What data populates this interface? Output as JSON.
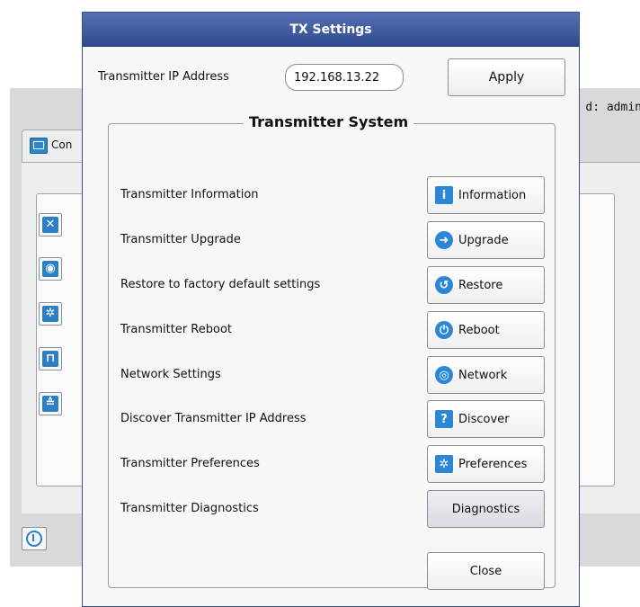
{
  "background": {
    "user_text": "d: admin",
    "tab_label": "Con",
    "icons": [
      "tools-icon",
      "globe-icon",
      "gear-icon",
      "lock-icon",
      "broadcast-icon"
    ],
    "footer_icon": "info-icon"
  },
  "dialog": {
    "title": "TX Settings",
    "ip_label": "Transmitter IP Address",
    "ip_value": "192.168.13.22",
    "apply_label": "Apply",
    "group_title": "Transmitter System",
    "rows": [
      {
        "label": "Transmitter Information",
        "button": "Information",
        "icon": "info-icon"
      },
      {
        "label": "Transmitter Upgrade",
        "button": "Upgrade",
        "icon": "upgrade-icon"
      },
      {
        "label": "Restore to factory default settings",
        "button": "Restore",
        "icon": "restore-icon"
      },
      {
        "label": "Transmitter Reboot",
        "button": "Reboot",
        "icon": "power-icon"
      },
      {
        "label": "Network Settings",
        "button": "Network",
        "icon": "network-icon"
      },
      {
        "label": "Discover Transmitter IP Address",
        "button": "Discover",
        "icon": "question-icon"
      },
      {
        "label": "Transmitter Preferences",
        "button": "Preferences",
        "icon": "gear-icon"
      },
      {
        "label": "Transmitter Diagnostics",
        "button": "Diagnostics"
      }
    ],
    "close_label": "Close"
  },
  "colors": {
    "titlebar": "#3d5798",
    "accent_icon": "#2b86d6"
  }
}
